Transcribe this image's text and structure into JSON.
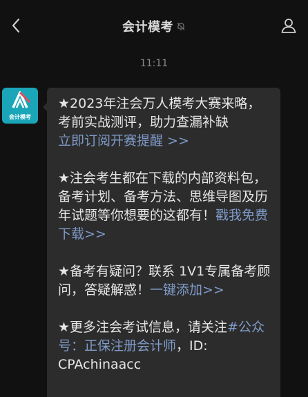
{
  "header": {
    "title": "会计模考",
    "back_icon": "chevron-left-icon",
    "mute_icon": "bell-slash-icon",
    "profile_icon": "person-icon"
  },
  "timestamp": "11:11",
  "avatar": {
    "label": "会计模考",
    "color": "#1aa6b8"
  },
  "message": {
    "p1_text": "★2023年注会万人模考大赛来略，考前实战测评，助力查漏补缺",
    "p1_link": "立即订阅开赛提醒 >>",
    "p2_text": "★注会考生都在下载的内部资料包，备考计划、备考方法、思维导图及历年试题等你想要的这都有！",
    "p2_link": "戳我免费下载>>",
    "p3_text": "★备考有疑问？联系 1V1专属备考顾问，答疑解惑！",
    "p3_link": "一键添加>>",
    "p4_text": "★更多注会考试信息，请关注",
    "p4_link": "#公众号：正保注册会计师",
    "p4_tail": "，ID: CPAchinaacc"
  },
  "colors": {
    "background": "#111111",
    "bubble": "#2c2c2c",
    "link": "#7f9bc9"
  }
}
